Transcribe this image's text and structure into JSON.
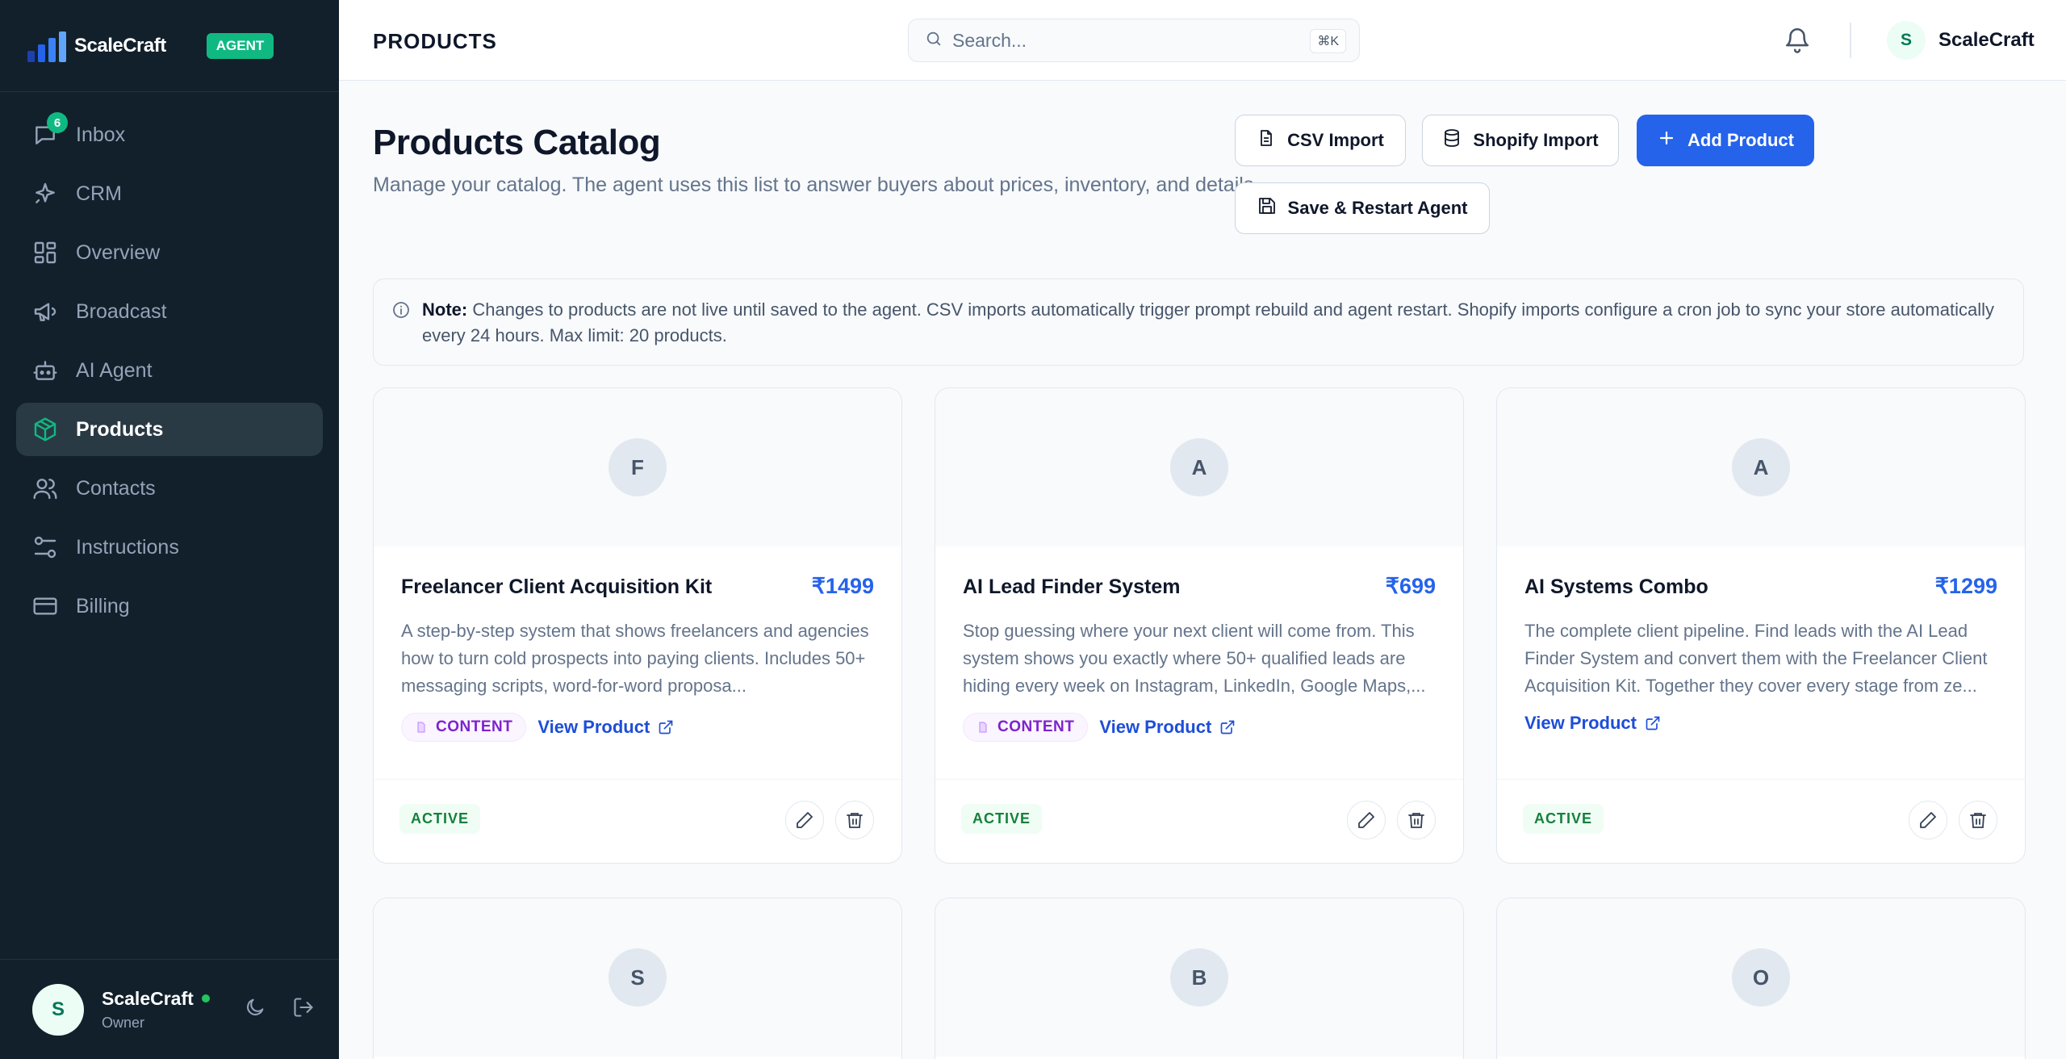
{
  "brand": {
    "name": "ScaleCraft",
    "badge": "AGENT"
  },
  "sidebar": {
    "items": [
      {
        "label": "Inbox",
        "icon": "message-icon",
        "badge": "6"
      },
      {
        "label": "CRM",
        "icon": "sparkle-icon"
      },
      {
        "label": "Overview",
        "icon": "grid-icon"
      },
      {
        "label": "Broadcast",
        "icon": "megaphone-icon"
      },
      {
        "label": "AI Agent",
        "icon": "bot-icon"
      },
      {
        "label": "Products",
        "icon": "package-icon",
        "active": true
      },
      {
        "label": "Contacts",
        "icon": "users-icon"
      },
      {
        "label": "Instructions",
        "icon": "sliders-icon"
      },
      {
        "label": "Billing",
        "icon": "credit-card-icon"
      }
    ],
    "footer": {
      "avatar_initial": "S",
      "name": "ScaleCraft",
      "role": "Owner"
    }
  },
  "topbar": {
    "page_label": "PRODUCTS",
    "search_placeholder": "Search...",
    "shortcut": "⌘K",
    "user_initial": "S",
    "user_name": "ScaleCraft"
  },
  "main": {
    "title": "Products Catalog",
    "subtitle": "Manage your catalog. The agent uses this list to answer buyers about prices, inventory, and details.",
    "buttons": {
      "csv_import": "CSV Import",
      "shopify_import": "Shopify Import",
      "add_product": "Add Product",
      "save_restart": "Save & Restart Agent"
    },
    "note": {
      "label": "Note:",
      "text": "Changes to products are not live until saved to the agent. CSV imports automatically trigger prompt rebuild and agent restart. Shopify imports configure a cron job to sync your store automatically every 24 hours. Max limit: 20 products."
    },
    "products": [
      {
        "initial": "F",
        "title": "Freelancer Client Acquisition Kit",
        "price": "₹1499",
        "description": "A step-by-step system that shows freelancers and agencies how to turn cold prospects into paying clients. Includes 50+ messaging scripts, word-for-word proposa...",
        "tag": "CONTENT",
        "link": "View Product",
        "status": "ACTIVE"
      },
      {
        "initial": "A",
        "title": "AI Lead Finder System",
        "price": "₹699",
        "description": "Stop guessing where your next client will come from. This system shows you exactly where 50+ qualified leads are hiding every week on Instagram, LinkedIn, Google Maps,...",
        "tag": "CONTENT",
        "link": "View Product",
        "status": "ACTIVE"
      },
      {
        "initial": "A",
        "title": "AI Systems Combo",
        "price": "₹1299",
        "description": "The complete client pipeline. Find leads with the AI Lead Finder System and convert them with the Freelancer Client Acquisition Kit. Together they cover every stage from ze...",
        "link": "View Product",
        "status": "ACTIVE"
      }
    ],
    "more_products": [
      {
        "initial": "S"
      },
      {
        "initial": "B"
      },
      {
        "initial": "O"
      }
    ]
  },
  "colors": {
    "sidebar_bg": "#12202b",
    "accent_blue": "#2563eb",
    "agent_green": "#10b981",
    "content_purple": "#7e22ce",
    "active_green": "#15803d"
  }
}
